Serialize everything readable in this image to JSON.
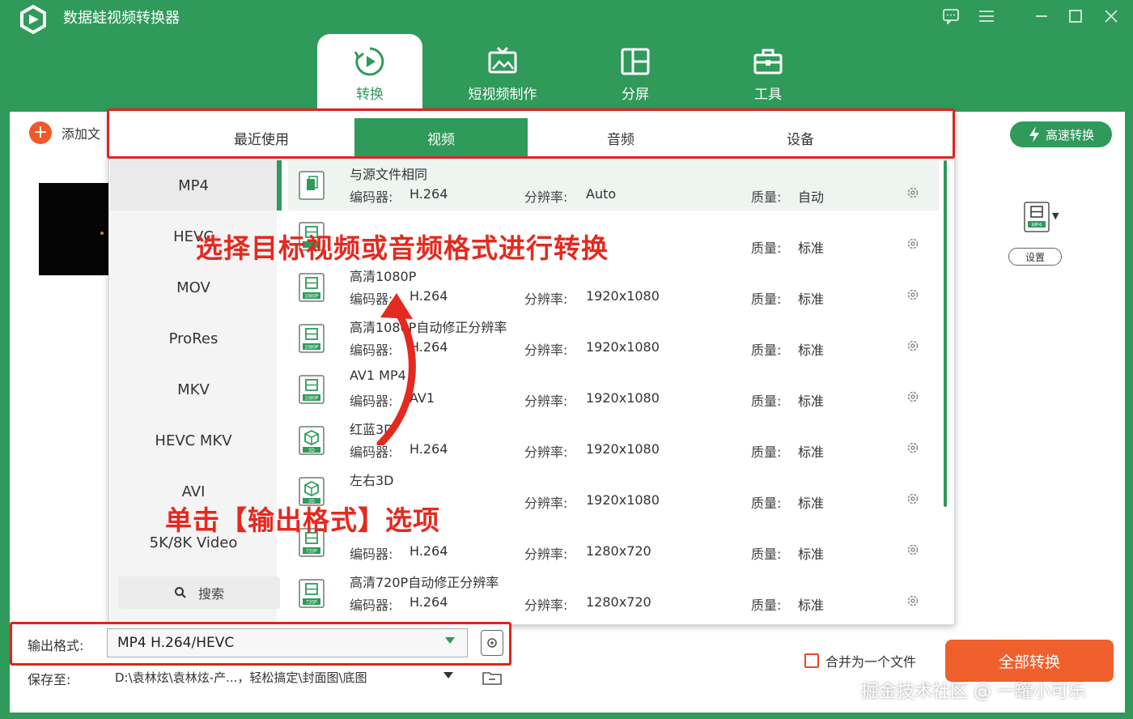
{
  "app": {
    "title": "数据蛙视频转换器"
  },
  "nav": [
    {
      "label": "转换"
    },
    {
      "label": "短视频制作"
    },
    {
      "label": "分屏"
    },
    {
      "label": "工具"
    }
  ],
  "toolbar": {
    "add_file": "添加文",
    "speed_convert": "高速转换",
    "settings": "设置",
    "file_icon_badge": "MP4"
  },
  "categories": [
    {
      "label": "最近使用"
    },
    {
      "label": "视频"
    },
    {
      "label": "音频"
    },
    {
      "label": "设备"
    }
  ],
  "formats": [
    "MP4",
    "HEVC",
    "MOV",
    "ProRes",
    "MKV",
    "HEVC MKV",
    "AVI",
    "5K/8K Video"
  ],
  "format_search": "搜索",
  "labels": {
    "codec": "编码器:",
    "resolution": "分辨率:",
    "quality": "质量:"
  },
  "presets": [
    {
      "name": "与源文件相同",
      "codec": "H.264",
      "resolution": "Auto",
      "quality": "自动",
      "badge": ""
    },
    {
      "name": "",
      "codec": "",
      "resolution": "",
      "quality": "标准",
      "badge": ""
    },
    {
      "name": "高清1080P",
      "codec": "H.264",
      "resolution": "1920x1080",
      "quality": "标准",
      "badge": "1080P"
    },
    {
      "name": "高清1080P自动修正分辨率",
      "codec": "H.264",
      "resolution": "1920x1080",
      "quality": "标准",
      "badge": "1080P"
    },
    {
      "name": "AV1 MP4",
      "codec": "AV1",
      "resolution": "1920x1080",
      "quality": "标准",
      "badge": "1080P"
    },
    {
      "name": "红蓝3D",
      "codec": "H.264",
      "resolution": "1920x1080",
      "quality": "标准",
      "badge": "3D"
    },
    {
      "name": "左右3D",
      "codec": "",
      "resolution": "1920x1080",
      "quality": "标准",
      "badge": "3D"
    },
    {
      "name": "",
      "codec": "H.264",
      "resolution": "1280x720",
      "quality": "标准",
      "badge": "720P"
    },
    {
      "name": "高清720P自动修正分辨率",
      "codec": "H.264",
      "resolution": "1280x720",
      "quality": "标准",
      "badge": "720P"
    }
  ],
  "annotations": {
    "top": "选择目标视频或音频格式进行转换",
    "bottom": "单击【输出格式】选项"
  },
  "bottom": {
    "output_label": "输出格式:",
    "output_value": "MP4 H.264/HEVC",
    "save_label": "保存至:",
    "save_path": "D:\\袁林炫\\袁林炫-产...，轻松搞定\\封面图\\底图",
    "merge_label": "合并为一个文件",
    "convert_all": "全部转换"
  },
  "watermark": "掘金技术社区 @ 一罐小可乐",
  "colors": {
    "brand": "#2f9a5a",
    "accent": "#f0602c",
    "annotation": "#e4291f"
  }
}
